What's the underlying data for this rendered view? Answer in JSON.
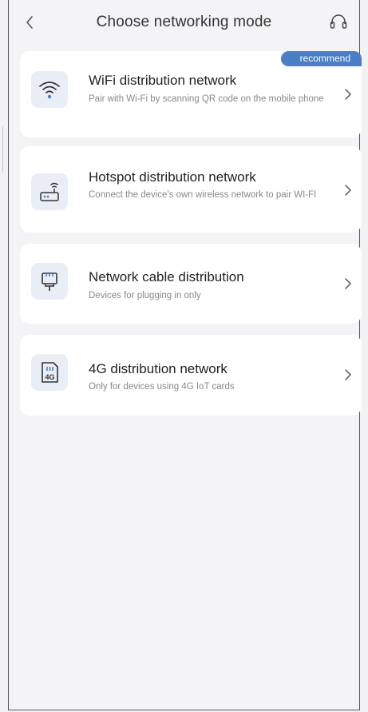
{
  "header": {
    "title": "Choose networking mode",
    "back_icon": "chevron-left-icon",
    "support_icon": "headset-icon"
  },
  "options": [
    {
      "name": "WiFi distribution network",
      "desc": "Pair with Wi-Fi by scanning QR code on the mobile phone",
      "badge": "recommend",
      "icon": "wifi-icon"
    },
    {
      "name": "Hotspot distribution network",
      "desc": "Connect the device's own wireless network to pair WI-FI",
      "icon": "hotspot-router-icon"
    },
    {
      "name": "Network cable distribution",
      "desc": "Devices for plugging in only",
      "icon": "ethernet-plug-icon"
    },
    {
      "name": "4G distribution network",
      "desc": "Only for devices using 4G IoT cards",
      "icon": "sim-4g-icon",
      "icon_text": "4G"
    }
  ],
  "colors": {
    "accent": "#4a7fc8",
    "icon_bg": "#e9eef6",
    "background": "#f4f4f6"
  }
}
